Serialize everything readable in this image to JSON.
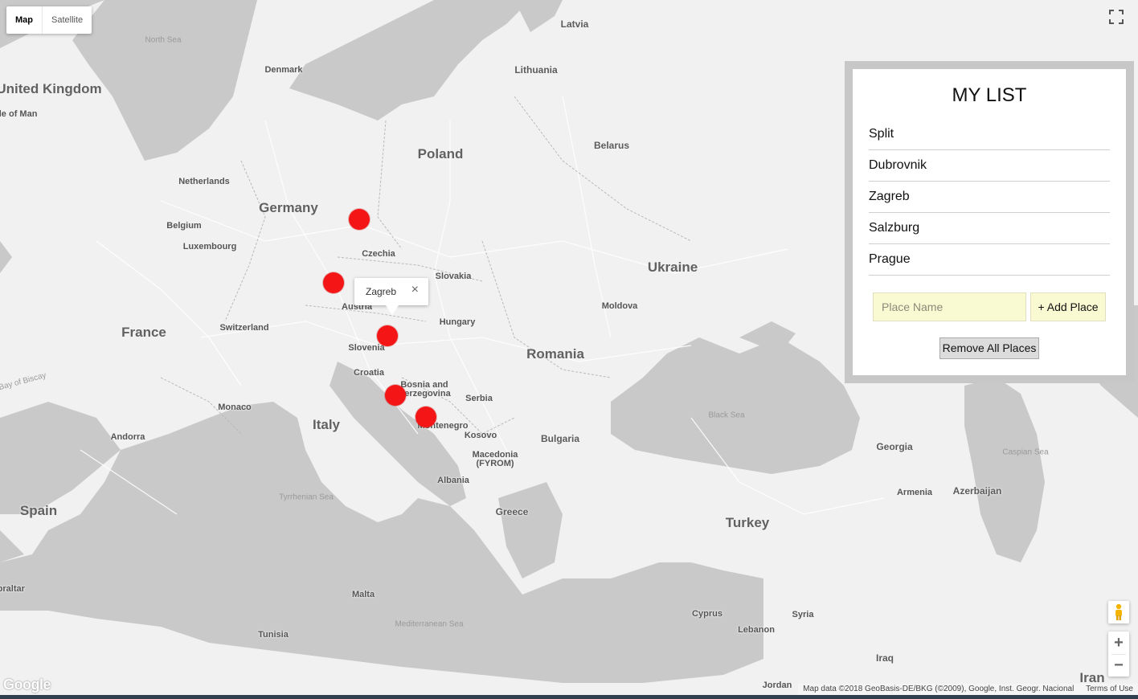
{
  "map_controls": {
    "map_label": "Map",
    "satellite_label": "Satellite",
    "fullscreen_icon": "fullscreen-icon",
    "pegman_icon": "pegman-icon",
    "zoom_in_label": "+",
    "zoom_out_label": "−"
  },
  "map_labels": {
    "countries": [
      "United Kingdom",
      "Germany",
      "Poland",
      "France",
      "Spain",
      "Italy",
      "Romania",
      "Ukraine",
      "Turkey",
      "Belarus"
    ],
    "regions": [
      "Latvia",
      "Lithuania",
      "Denmark",
      "Netherlands",
      "Belgium",
      "Luxembourg",
      "Czechia",
      "Slovakia",
      "Austria",
      "Switzerland",
      "Hungary",
      "Slovenia",
      "Croatia",
      "Bosnia and Herzegovina",
      "Serbia",
      "Montenegro",
      "Kosovo",
      "Macedonia (FYROM)",
      "Bulgaria",
      "Albania",
      "Greece",
      "Moldova",
      "Georgia",
      "Armenia",
      "Azerbaijan",
      "Syria",
      "Lebanon",
      "Iraq",
      "Iran",
      "Jordan",
      "Cyprus",
      "Tunisia",
      "Malta",
      "Monaco",
      "Andorra",
      "Isle of Man",
      "Gibraltar"
    ],
    "seas": [
      "North Sea",
      "Black Sea",
      "Caspian Sea",
      "Tyrrhenian Sea",
      "Mediterranean Sea",
      "Bay of Biscay"
    ]
  },
  "info_window": {
    "title": "Zagreb",
    "close": "×"
  },
  "panel": {
    "title": "MY LIST",
    "places": [
      "Split",
      "Dubrovnik",
      "Zagreb",
      "Salzburg",
      "Prague"
    ],
    "input_placeholder": "Place Name",
    "add_button": "+ Add Place",
    "remove_button": "Remove All Places"
  },
  "footer": {
    "logo": "Google",
    "attribution": "Map data ©2018 GeoBasis-DE/BKG (©2009), Google, Inst. Geogr. Nacional",
    "terms": "Terms of Use"
  },
  "colors": {
    "marker": "#f41616",
    "water": "#c9c9c9",
    "land": "#f1f1f1",
    "panel_border": "#c7c7c7",
    "input_bg": "#fafad2"
  }
}
